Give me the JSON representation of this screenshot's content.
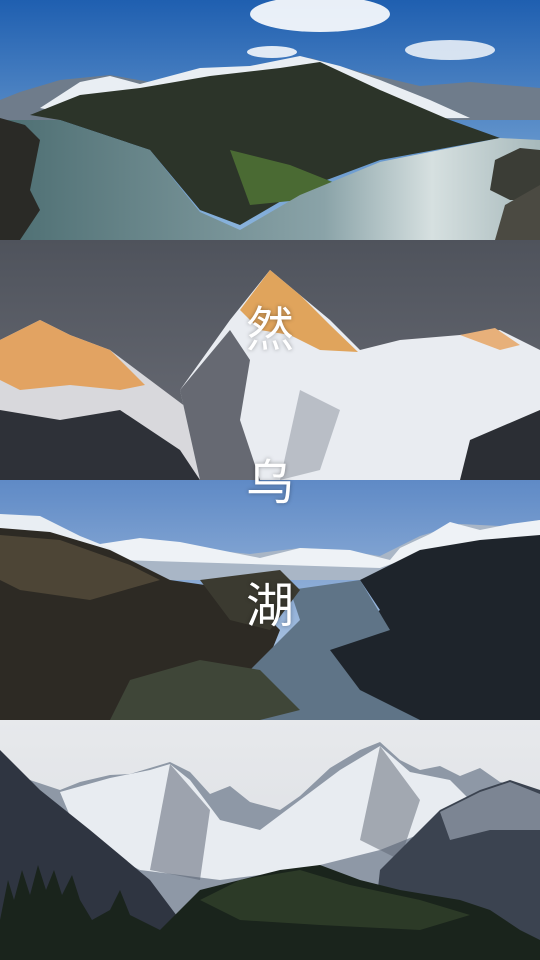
{
  "title": {
    "chars": [
      "然",
      "乌",
      "湖"
    ]
  },
  "colors": {
    "sky_blue": "#2f6fb8",
    "lake": "#7d9aa6",
    "dusk_sky": "#5d6068",
    "alpenglow": "#e6a15a",
    "snow": "#eef1f5",
    "forest": "#1d2a22"
  }
}
